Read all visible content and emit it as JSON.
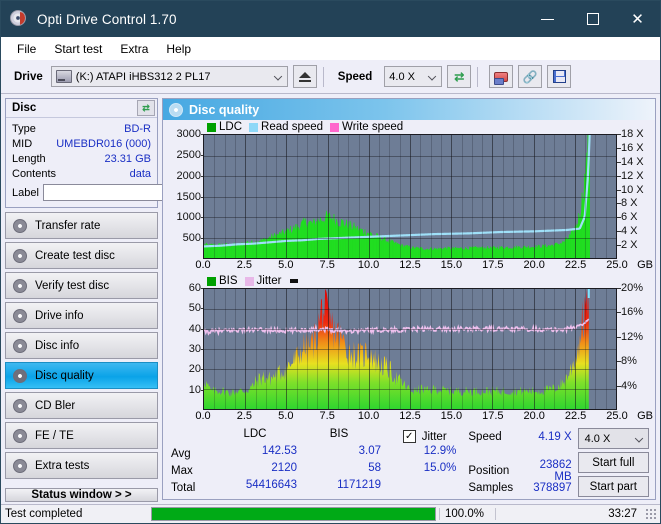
{
  "window": {
    "title": "Opti Drive Control 1.70",
    "icon": "disc-icon",
    "minimize": "−",
    "maximize": "□",
    "close": "✕"
  },
  "menu": {
    "items": [
      "File",
      "Start test",
      "Extra",
      "Help"
    ]
  },
  "toolbar": {
    "drive_label": "Drive",
    "drive_value": "(K:)  ATAPI iHBS312  2 PL17",
    "eject_icon": "eject-icon",
    "speed_label": "Speed",
    "speed_value": "4.0 X",
    "refresh_icon": "refresh-icon",
    "eraser_icon": "eraser-icon",
    "chain_icon": "chain-icon",
    "save_icon": "save-icon"
  },
  "disc_panel": {
    "title": "Disc",
    "refresh_icon": "refresh-icon",
    "rows": [
      {
        "key": "Type",
        "value": "BD-R"
      },
      {
        "key": "MID",
        "value": "UMEBDR016 (000)"
      },
      {
        "key": "Length",
        "value": "23.31 GB"
      },
      {
        "key": "Contents",
        "value": "data"
      }
    ],
    "label_key": "Label",
    "label_value": "",
    "label_placeholder": "",
    "label_button_icon": "cd-icon"
  },
  "sidebar": {
    "items": [
      {
        "label": "Transfer rate",
        "icon": "disc-icon",
        "active": false
      },
      {
        "label": "Create test disc",
        "icon": "disc-icon",
        "active": false
      },
      {
        "label": "Verify test disc",
        "icon": "disc-icon",
        "active": false
      },
      {
        "label": "Drive info",
        "icon": "disc-icon",
        "active": false
      },
      {
        "label": "Disc info",
        "icon": "disc-icon",
        "active": false
      },
      {
        "label": "Disc quality",
        "icon": "disc-icon",
        "active": true
      },
      {
        "label": "CD Bler",
        "icon": "disc-icon",
        "active": false
      },
      {
        "label": "FE / TE",
        "icon": "disc-icon",
        "active": false
      },
      {
        "label": "Extra tests",
        "icon": "disc-icon",
        "active": false
      }
    ],
    "status_window_button": "Status window > >"
  },
  "main": {
    "title": "Disc quality",
    "icon": "disc-icon"
  },
  "chart_data": [
    {
      "type": "area",
      "name": "top-chart",
      "title": "",
      "xlabel": "GB",
      "ylabel": "",
      "x_unit": "GB",
      "xlim": [
        0,
        25
      ],
      "xticks": [
        "0.0",
        "2.5",
        "5.0",
        "7.5",
        "10.0",
        "12.5",
        "15.0",
        "17.5",
        "20.0",
        "22.5",
        "25.0"
      ],
      "ylim": [
        0,
        3000
      ],
      "yticks": [
        "500",
        "1000",
        "1500",
        "2000",
        "2500",
        "3000"
      ],
      "y2lim": [
        0,
        18
      ],
      "y2ticks": [
        "2 X",
        "4 X",
        "6 X",
        "8 X",
        "10 X",
        "12 X",
        "14 X",
        "16 X",
        "18 X"
      ],
      "grid": true,
      "legend": [
        {
          "name": "LDC",
          "color": "#00a000"
        },
        {
          "name": "Read speed",
          "color": "#8ed8f8"
        },
        {
          "name": "Write speed",
          "color": "#ff66cc"
        }
      ],
      "series": [
        {
          "name": "LDC",
          "color": "#22dd22",
          "x": [
            0.0,
            0.3,
            0.6,
            0.9,
            1.2,
            1.5,
            1.8,
            2.1,
            2.4,
            2.7,
            3.0,
            3.3,
            3.6,
            3.9,
            4.2,
            4.5,
            4.8,
            5.1,
            5.4,
            5.7,
            6.0,
            6.3,
            6.6,
            6.9,
            7.2,
            7.5,
            7.8,
            8.1,
            8.4,
            8.7,
            9.0,
            9.3,
            9.6,
            9.9,
            10.2,
            10.5,
            10.8,
            11.1,
            11.4,
            11.7,
            12.0,
            12.3,
            12.6,
            12.9,
            13.2,
            13.5,
            13.8,
            14.1,
            14.4,
            14.7,
            15.0,
            15.6,
            16.2,
            16.8,
            17.4,
            18.0,
            18.6,
            19.2,
            19.8,
            20.4,
            21.0,
            21.4,
            21.8,
            22.1,
            22.4,
            22.7,
            22.9,
            23.1,
            23.25,
            23.4
          ],
          "values": [
            330,
            300,
            320,
            310,
            330,
            300,
            320,
            310,
            350,
            400,
            360,
            420,
            430,
            480,
            520,
            560,
            600,
            660,
            700,
            760,
            830,
            880,
            820,
            900,
            950,
            1000,
            960,
            900,
            860,
            800,
            760,
            700,
            660,
            620,
            580,
            520,
            480,
            420,
            380,
            340,
            300,
            280,
            250,
            240,
            230,
            220,
            230,
            220,
            230,
            240,
            230,
            235,
            240,
            250,
            245,
            255,
            260,
            265,
            270,
            280,
            300,
            330,
            380,
            480,
            620,
            900,
            1300,
            1900,
            2450,
            3000
          ]
        },
        {
          "name": "Read speed",
          "color": "#9fe0f8",
          "x": [
            0.0,
            1.0,
            2.0,
            3.0,
            4.0,
            5.0,
            6.0,
            7.0,
            8.0,
            9.0,
            10.0,
            11.0,
            12.0,
            13.0,
            14.0,
            15.0,
            16.0,
            17.0,
            18.0,
            19.0,
            20.0,
            21.0,
            22.0,
            22.8,
            23.1,
            23.3,
            23.4
          ],
          "values": [
            1.7,
            1.8,
            2.0,
            2.1,
            2.3,
            2.5,
            2.6,
            2.8,
            2.9,
            3.0,
            3.1,
            3.2,
            3.3,
            3.4,
            3.5,
            3.55,
            3.6,
            3.7,
            3.8,
            3.85,
            3.9,
            4.0,
            4.1,
            4.3,
            6.0,
            12.0,
            18.0
          ]
        }
      ]
    },
    {
      "type": "area",
      "name": "bottom-chart",
      "title": "",
      "xlabel": "GB",
      "x_unit": "GB",
      "xlim": [
        0,
        25
      ],
      "xticks": [
        "0.0",
        "2.5",
        "5.0",
        "7.5",
        "10.0",
        "12.5",
        "15.0",
        "17.5",
        "20.0",
        "22.5",
        "25.0"
      ],
      "ylim": [
        0,
        60
      ],
      "yticks": [
        "10",
        "20",
        "30",
        "40",
        "50",
        "60"
      ],
      "y2lim": [
        0,
        20
      ],
      "y2ticks": [
        "4%",
        "8%",
        "12%",
        "16%",
        "20%"
      ],
      "grid": true,
      "legend": [
        {
          "name": "BIS",
          "color": "#00a000"
        },
        {
          "name": "Jitter",
          "color": "#e8b8e8"
        }
      ],
      "series": [
        {
          "name": "BIS",
          "color": "gradient-green-yellow-red",
          "x": [
            0.0,
            0.4,
            0.8,
            1.2,
            1.6,
            2.0,
            2.4,
            2.8,
            3.2,
            3.6,
            4.0,
            4.4,
            4.8,
            5.2,
            5.6,
            6.0,
            6.4,
            6.8,
            7.2,
            7.6,
            8.0,
            8.4,
            8.8,
            9.2,
            9.6,
            10.0,
            10.4,
            10.8,
            11.2,
            11.6,
            12.0,
            12.4,
            12.8,
            13.2,
            13.6,
            14.0,
            14.8,
            15.6,
            16.4,
            17.2,
            18.0,
            18.8,
            19.6,
            20.4,
            21.2,
            21.8,
            22.3,
            22.7,
            23.0,
            23.2,
            23.35
          ],
          "values": [
            15,
            9,
            9,
            9,
            8,
            9,
            9,
            10,
            14,
            16,
            15,
            17,
            19,
            22,
            25,
            31,
            30,
            36,
            51,
            43,
            38,
            34,
            29,
            27,
            26,
            30,
            24,
            22,
            20,
            16,
            13,
            10,
            9,
            10,
            9,
            10,
            9,
            9,
            9,
            9,
            9,
            9,
            9,
            9,
            10,
            13,
            20,
            30,
            45,
            55,
            58
          ]
        },
        {
          "name": "Jitter",
          "color": "#e8b8e8",
          "x": [
            0.0,
            1.0,
            2.0,
            3.0,
            4.0,
            5.0,
            6.0,
            7.0,
            8.0,
            9.0,
            10.0,
            11.0,
            12.0,
            13.0,
            14.0,
            15.0,
            16.0,
            17.0,
            18.0,
            19.0,
            20.0,
            21.0,
            22.0,
            22.6,
            23.0,
            23.3
          ],
          "values": [
            38.5,
            39.0,
            39.5,
            39.5,
            39.5,
            39.0,
            39.5,
            40.0,
            39.5,
            39.0,
            39.5,
            39.5,
            39.5,
            40.0,
            40.0,
            40.0,
            40.0,
            40.0,
            40.0,
            40.0,
            40.0,
            39.5,
            40.0,
            41.0,
            42.5,
            45.0
          ]
        }
      ]
    }
  ],
  "stats": {
    "col_headers": [
      "LDC",
      "BIS"
    ],
    "row_labels": [
      "Avg",
      "Max",
      "Total"
    ],
    "ldc": {
      "avg": "142.53",
      "max": "2120",
      "total": "54416643"
    },
    "bis": {
      "avg": "3.07",
      "max": "58",
      "total": "1171219"
    },
    "jitter": {
      "label": "Jitter",
      "checked": true,
      "check_glyph": "✓",
      "avg": "12.9%",
      "max": "15.0%"
    },
    "speed_label": "Speed",
    "speed_value": "4.19 X",
    "position_label": "Position",
    "position_value": "23862 MB",
    "samples_label": "Samples",
    "samples_value": "378897",
    "speed_select": "4.0 X",
    "start_full_button": "Start full",
    "start_part_button": "Start part"
  },
  "statusbar": {
    "message": "Test completed",
    "progress_percent": "100.0%",
    "progress_value": 100,
    "elapsed": "33:27"
  },
  "colors": {
    "titlebar": "#234257",
    "accent": "#1a2fc4",
    "plot_bg": "#6e7d96",
    "progress": "#00aa16",
    "active_nav": "#0aa3e8"
  }
}
